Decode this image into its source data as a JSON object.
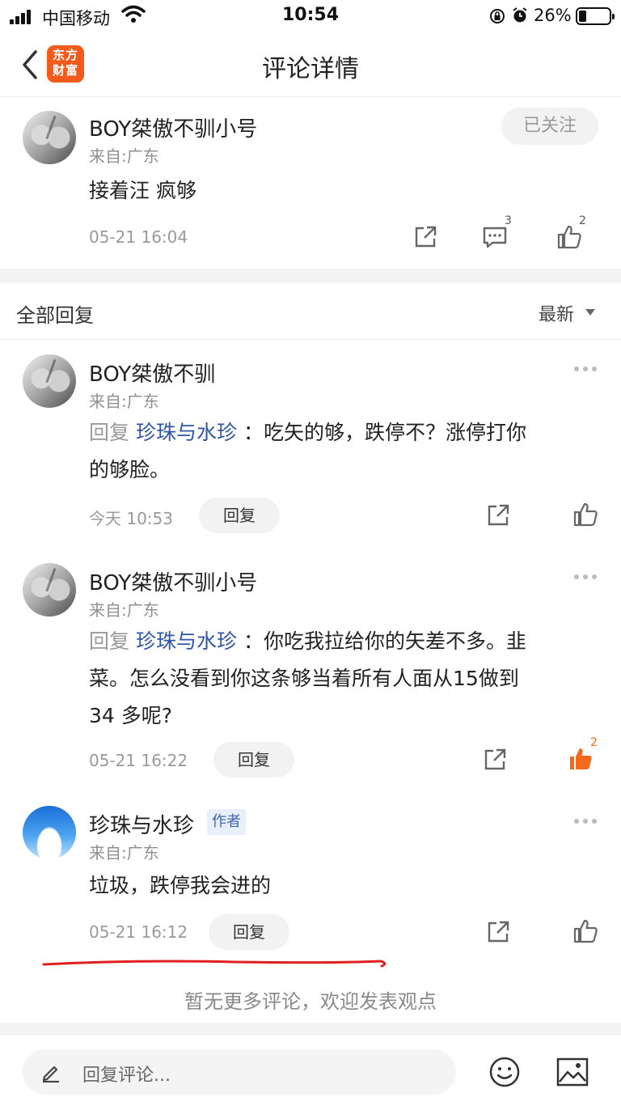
{
  "status_bar": {
    "carrier": "中国移动",
    "time": "10:54",
    "battery": "26%"
  },
  "nav": {
    "logo_line1": "东方",
    "logo_line2": "财富",
    "title": "评论详情"
  },
  "main_comment": {
    "username": "BOY桀傲不驯小号",
    "location": "来自:广东",
    "follow_label": "已关注",
    "text": "接着汪  疯够",
    "time": "05-21 16:04",
    "comment_count": "3",
    "like_count": "2"
  },
  "replies_header": {
    "title": "全部回复",
    "sort_label": "最新"
  },
  "replies": [
    {
      "username": "BOY桀傲不驯",
      "location": "来自:广东",
      "prefix": "回复",
      "target": "珍珠与水珍",
      "text_line1": "：吃矢的够，跌停不？涨停打你",
      "text_line2": "的够脸。",
      "time": "今天 10:53",
      "reply_label": "回复"
    },
    {
      "username": "BOY桀傲不驯小号",
      "location": "来自:广东",
      "prefix": "回复",
      "target": "珍珠与水珍",
      "text_line1": "：你吃我拉给你的矢差不多。韭",
      "text_line2": "菜。怎么没看到你这条够当着所有人面从15做到",
      "text_line3": "34 多呢?",
      "time": "05-21 16:22",
      "reply_label": "回复",
      "like_count": "2"
    },
    {
      "username": "珍珠与水珍",
      "badge": "作者",
      "location": "来自:广东",
      "text": "垃圾，跌停我会进的",
      "time": "05-21 16:12",
      "reply_label": "回复"
    }
  ],
  "footer_note": "暂无更多评论，欢迎发表观点",
  "bottom_bar": {
    "placeholder": "回复评论..."
  },
  "colors": {
    "brand": "#f25b1c",
    "link": "#2f56a8",
    "liked": "#f26a1b",
    "annotation": "#e02020"
  }
}
